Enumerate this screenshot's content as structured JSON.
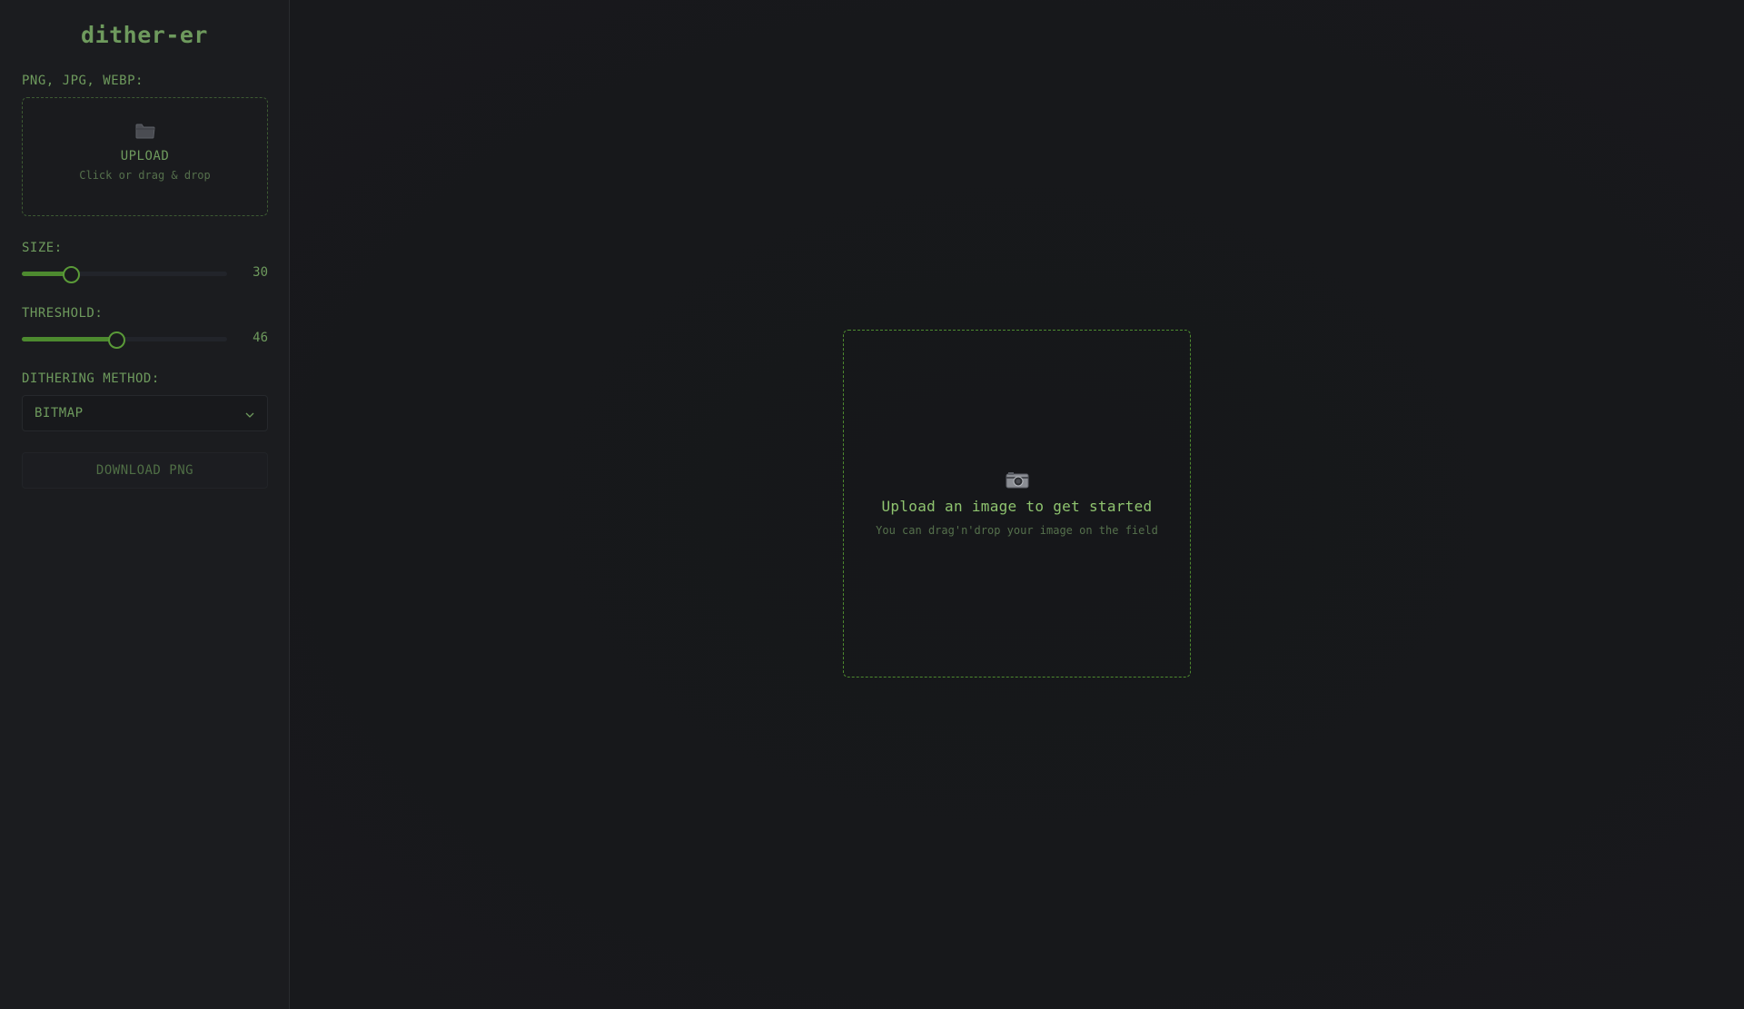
{
  "app": {
    "logo": "dither-er"
  },
  "sidebar": {
    "formats_label": "PNG, JPG, WEBP:",
    "upload": {
      "icon": "folder-icon",
      "title": "UPLOAD",
      "subtitle": "Click or drag & drop"
    },
    "size": {
      "label": "SIZE:",
      "value": "30",
      "fraction": 0.24
    },
    "threshold": {
      "label": "THRESHOLD:",
      "value": "46",
      "fraction": 0.46
    },
    "method": {
      "label": "DITHERING METHOD:",
      "selected": "BITMAP"
    },
    "download_label": "DOWNLOAD PNG"
  },
  "main": {
    "dropzone": {
      "icon": "camera-icon",
      "title": "Upload an image to get started",
      "subtitle": "You can drag'n'drop your image on the field"
    }
  },
  "colors": {
    "accent": "#4d8a2f",
    "text_green": "#6e9a5d",
    "background": "#17181b"
  }
}
